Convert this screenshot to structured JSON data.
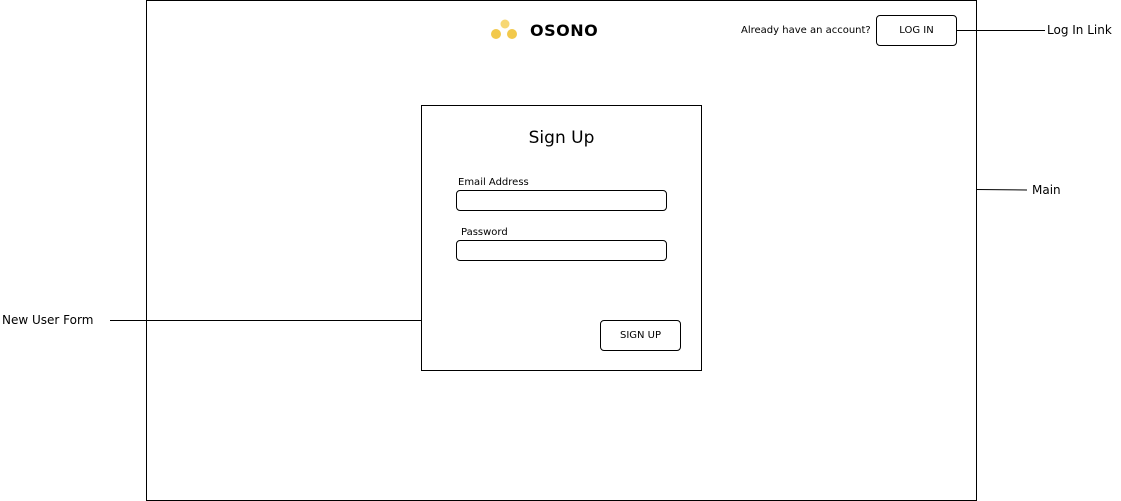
{
  "header": {
    "brand_name": "OSONO",
    "logo_icon": "three-dots-logo-icon",
    "account_prompt": "Already have an account?",
    "login_label": "LOG IN"
  },
  "form": {
    "title": "Sign Up",
    "email_label": "Email Address",
    "email_value": "",
    "password_label": "Password",
    "password_value": "",
    "submit_label": "SIGN UP"
  },
  "annotations": {
    "login_link": "Log In Link",
    "main": "Main",
    "new_user_form": "New User Form"
  },
  "colors": {
    "logo_accent": "#F5D05A",
    "border": "#000000",
    "background": "#FFFFFF"
  }
}
